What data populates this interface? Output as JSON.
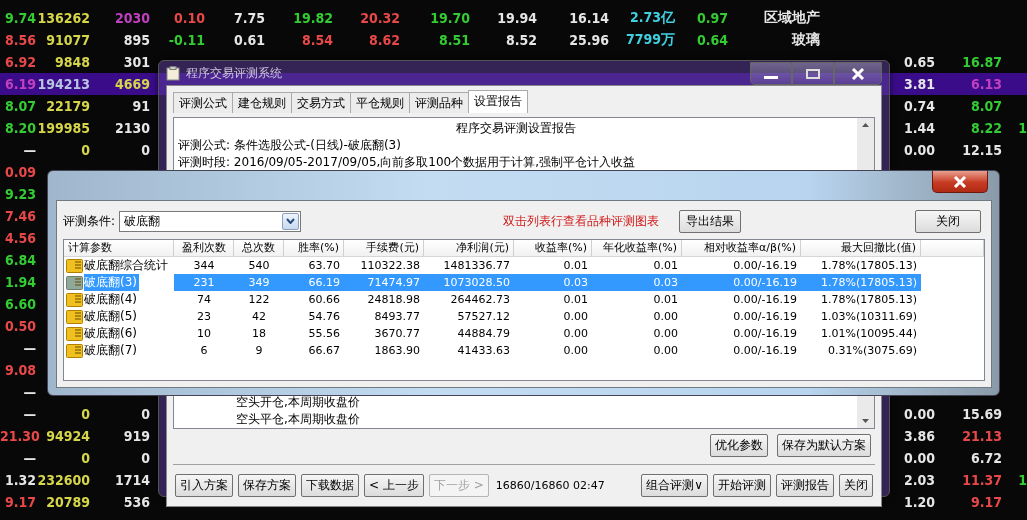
{
  "quote_board": {
    "rows": [
      {
        "highlighted": false,
        "left": [
          {
            "text": "9.74",
            "color": "#33cc33"
          },
          {
            "text": "136262",
            "color": "#d6d64a"
          },
          {
            "text": "2030",
            "color": "#c040c0"
          }
        ],
        "middle": [
          {
            "text": "0.10",
            "color": "#e84848"
          },
          {
            "text": "7.75",
            "color": "#e6e6e6"
          },
          {
            "text": "19.82",
            "color": "#33cc33"
          },
          {
            "text": "20.32",
            "color": "#e84848"
          },
          {
            "text": "19.70",
            "color": "#33cc33"
          },
          {
            "text": "19.94",
            "color": "#e6e6e6"
          },
          {
            "text": "16.14",
            "color": "#e6e6e6"
          },
          {
            "text": "2.73亿",
            "color": "#40d0e0"
          },
          {
            "text": "0.97",
            "color": "#33cc33"
          },
          {
            "text": "区域地产",
            "color": "#e6e6e6"
          }
        ],
        "right": []
      },
      {
        "highlighted": false,
        "left": [
          {
            "text": "8.56",
            "color": "#e84848"
          },
          {
            "text": "91077",
            "color": "#d6d64a"
          },
          {
            "text": "895",
            "color": "#e6e6e6"
          }
        ],
        "middle": [
          {
            "text": "-0.11",
            "color": "#33cc33"
          },
          {
            "text": "0.61",
            "color": "#e6e6e6"
          },
          {
            "text": "8.54",
            "color": "#e84848"
          },
          {
            "text": "8.62",
            "color": "#e84848"
          },
          {
            "text": "8.51",
            "color": "#33cc33"
          },
          {
            "text": "8.52",
            "color": "#e6e6e6"
          },
          {
            "text": "25.96",
            "color": "#e6e6e6"
          },
          {
            "text": "7799万",
            "color": "#40d0e0"
          },
          {
            "text": "0.64",
            "color": "#33cc33"
          },
          {
            "text": "玻璃",
            "color": "#e6e6e6"
          }
        ],
        "right": []
      },
      {
        "highlighted": false,
        "left": [
          {
            "text": "6.92",
            "color": "#e84848"
          },
          {
            "text": "9848",
            "color": "#d6d64a"
          },
          {
            "text": "301",
            "color": "#e6e6e6"
          }
        ],
        "middle": [],
        "right": [
          {
            "text": "0.65",
            "color": "#e6e6e6"
          },
          {
            "text": "16.87",
            "color": "#33cc33"
          }
        ]
      },
      {
        "highlighted": true,
        "left": [
          {
            "text": "6.19",
            "color": "#c040c0"
          },
          {
            "text": "194213",
            "color": "#b8c4e0"
          },
          {
            "text": "4669",
            "color": "#d6d64a"
          }
        ],
        "middle": [],
        "right": [
          {
            "text": "3.81",
            "color": "#e6e6e6"
          },
          {
            "text": "6.13",
            "color": "#c040c0"
          }
        ]
      },
      {
        "highlighted": false,
        "left": [
          {
            "text": "8.07",
            "color": "#33cc33"
          },
          {
            "text": "22179",
            "color": "#d6d64a"
          },
          {
            "text": "91",
            "color": "#e6e6e6"
          }
        ],
        "middle": [],
        "right": [
          {
            "text": "0.74",
            "color": "#e6e6e6"
          },
          {
            "text": "8.07",
            "color": "#33cc33"
          }
        ]
      },
      {
        "highlighted": false,
        "left": [
          {
            "text": "8.20",
            "color": "#33cc33"
          },
          {
            "text": "199985",
            "color": "#d6d64a"
          },
          {
            "text": "2130",
            "color": "#e6e6e6"
          }
        ],
        "middle": [],
        "right": [
          {
            "text": "1.44",
            "color": "#e6e6e6"
          },
          {
            "text": "8.22",
            "color": "#33cc33"
          },
          {
            "text": "1",
            "color": "#33cc33"
          }
        ]
      },
      {
        "highlighted": false,
        "left": [
          {
            "text": "—",
            "color": "#e6e6e6"
          },
          {
            "text": "0",
            "color": "#d6d64a"
          },
          {
            "text": "0",
            "color": "#e6e6e6"
          }
        ],
        "middle": [],
        "right": [
          {
            "text": "0.00",
            "color": "#e6e6e6"
          },
          {
            "text": "12.15",
            "color": "#e6e6e6"
          }
        ]
      },
      {
        "highlighted": false,
        "left": [
          {
            "text": "0.09",
            "color": "#e84848"
          }
        ],
        "middle": [],
        "right": []
      },
      {
        "highlighted": false,
        "left": [
          {
            "text": "9.23",
            "color": "#33cc33"
          }
        ],
        "middle": [],
        "right": []
      },
      {
        "highlighted": false,
        "left": [
          {
            "text": "7.46",
            "color": "#e84848"
          }
        ],
        "middle": [],
        "right": []
      },
      {
        "highlighted": false,
        "left": [
          {
            "text": "4.56",
            "color": "#e84848"
          }
        ],
        "middle": [],
        "right": []
      },
      {
        "highlighted": false,
        "left": [
          {
            "text": "6.84",
            "color": "#33cc33"
          }
        ],
        "middle": [],
        "right": []
      },
      {
        "highlighted": false,
        "left": [
          {
            "text": "1.94",
            "color": "#33cc33"
          }
        ],
        "middle": [],
        "right": []
      },
      {
        "highlighted": false,
        "left": [
          {
            "text": "6.60",
            "color": "#33cc33"
          }
        ],
        "middle": [],
        "right": []
      },
      {
        "highlighted": false,
        "left": [
          {
            "text": "0.50",
            "color": "#e84848"
          }
        ],
        "middle": [],
        "right": []
      },
      {
        "highlighted": false,
        "left": [
          {
            "text": "—",
            "color": "#e6e6e6"
          }
        ],
        "middle": [],
        "right": []
      },
      {
        "highlighted": false,
        "left": [
          {
            "text": "9.08",
            "color": "#e84848"
          }
        ],
        "middle": [],
        "right": []
      },
      {
        "highlighted": false,
        "left": [
          {
            "text": "—",
            "color": "#e6e6e6"
          }
        ],
        "middle": [],
        "right": []
      },
      {
        "highlighted": false,
        "left": [
          {
            "text": "—",
            "color": "#e6e6e6"
          },
          {
            "text": "0",
            "color": "#d6d64a"
          },
          {
            "text": "0",
            "color": "#e6e6e6"
          }
        ],
        "middle": [],
        "right": [
          {
            "text": "0.00",
            "color": "#e6e6e6"
          },
          {
            "text": "15.69",
            "color": "#e6e6e6"
          }
        ]
      },
      {
        "highlighted": false,
        "left": [
          {
            "text": "21.30",
            "color": "#e84848"
          },
          {
            "text": "94924",
            "color": "#d6d64a"
          },
          {
            "text": "919",
            "color": "#e6e6e6"
          }
        ],
        "middle": [],
        "right": [
          {
            "text": "3.86",
            "color": "#e6e6e6"
          },
          {
            "text": "21.13",
            "color": "#e84848"
          }
        ]
      },
      {
        "highlighted": false,
        "left": [
          {
            "text": "—",
            "color": "#e6e6e6"
          },
          {
            "text": "0",
            "color": "#d6d64a"
          },
          {
            "text": "0",
            "color": "#e6e6e6"
          }
        ],
        "middle": [],
        "right": [
          {
            "text": "0.00",
            "color": "#e6e6e6"
          },
          {
            "text": "6.72",
            "color": "#e6e6e6"
          }
        ]
      },
      {
        "highlighted": false,
        "left": [
          {
            "text": "1.32",
            "color": "#e6e6e6"
          },
          {
            "text": "232600",
            "color": "#d6d64a"
          },
          {
            "text": "1714",
            "color": "#e6e6e6"
          }
        ],
        "middle": [],
        "right": [
          {
            "text": "2.03",
            "color": "#e6e6e6"
          },
          {
            "text": "11.37",
            "color": "#e84848"
          },
          {
            "text": "1",
            "color": "#33cc33"
          }
        ]
      },
      {
        "highlighted": false,
        "left": [
          {
            "text": "9.17",
            "color": "#e84848"
          },
          {
            "text": "20789",
            "color": "#d6d64a"
          },
          {
            "text": "536",
            "color": "#e6e6e6"
          }
        ],
        "middle": [],
        "right": [
          {
            "text": "1.20",
            "color": "#e6e6e6"
          },
          {
            "text": "9.17",
            "color": "#e84848"
          }
        ]
      }
    ]
  },
  "main_window": {
    "title": "程序交易评测系统",
    "tabs": [
      {
        "label": "评测公式",
        "selected": false
      },
      {
        "label": "建仓规则",
        "selected": false
      },
      {
        "label": "交易方式",
        "selected": false
      },
      {
        "label": "平仓规则",
        "selected": false
      },
      {
        "label": "评测品种",
        "selected": false
      },
      {
        "label": "设置报告",
        "selected": true
      }
    ],
    "report": {
      "heading": "程序交易评测设置报告",
      "lines": [
        "评测公式: 条件选股公式-(日线)-破底翻(3)",
        "评测时段: 2016/09/05-2017/09/05,向前多取100个数据用于计算,强制平仓计入收益"
      ],
      "bottom_lines": [
        "空头开仓,本周期收盘价",
        "空头平仓,本周期收盘价"
      ]
    },
    "action_buttons": [
      "优化参数",
      "保存为默认方案"
    ],
    "toolbar": [
      {
        "kind": "button",
        "label": "引入方案",
        "disabled": false
      },
      {
        "kind": "button",
        "label": "保存方案",
        "disabled": false
      },
      {
        "kind": "button",
        "label": "下载数据",
        "disabled": false
      },
      {
        "kind": "button",
        "label": "< 上一步",
        "disabled": false
      },
      {
        "kind": "button",
        "label": "下一步 >",
        "disabled": true
      },
      {
        "kind": "status",
        "label": "16860/16860 02:47"
      },
      {
        "kind": "button",
        "label": "组合评测∨",
        "disabled": false
      },
      {
        "kind": "button",
        "label": "开始评测",
        "disabled": false
      },
      {
        "kind": "button",
        "label": "评测报告",
        "disabled": false
      },
      {
        "kind": "button",
        "label": "关闭",
        "disabled": false
      }
    ]
  },
  "result_dialog": {
    "condition_label": "评测条件:",
    "condition_value": "破底翻",
    "hint": "双击列表行查看品种评测图表",
    "export_button": "导出结果",
    "close_button": "关闭",
    "table": {
      "columns": [
        "计算参数",
        "盈利次数",
        "总次数",
        "胜率(%)",
        "手续费(元)",
        "净利润(元)",
        "收益率(%)",
        "年化收益率(%)",
        "相对收益率α/β(%)",
        "最大回撤比(值)"
      ],
      "rows": [
        {
          "selected": false,
          "cells": [
            "破底翻综合统计",
            "344",
            "540",
            "63.70",
            "110322.38",
            "1481336.77",
            "0.01",
            "0.01",
            "0.00/-16.19",
            "1.78%(17805.13)"
          ]
        },
        {
          "selected": true,
          "cells": [
            "破底翻(3)",
            "231",
            "349",
            "66.19",
            "71474.97",
            "1073028.50",
            "0.03",
            "0.03",
            "0.00/-16.19",
            "1.78%(17805.13)"
          ]
        },
        {
          "selected": false,
          "cells": [
            "破底翻(4)",
            "74",
            "122",
            "60.66",
            "24818.98",
            "264462.73",
            "0.01",
            "0.01",
            "0.00/-16.19",
            "1.78%(17805.13)"
          ]
        },
        {
          "selected": false,
          "cells": [
            "破底翻(5)",
            "23",
            "42",
            "54.76",
            "8493.77",
            "57527.12",
            "0.00",
            "0.00",
            "0.00/-16.19",
            "1.03%(10311.69)"
          ]
        },
        {
          "selected": false,
          "cells": [
            "破底翻(6)",
            "10",
            "18",
            "55.56",
            "3670.77",
            "44884.79",
            "0.00",
            "0.00",
            "0.00/-16.19",
            "1.01%(10095.44)"
          ]
        },
        {
          "selected": false,
          "cells": [
            "破底翻(7)",
            "6",
            "9",
            "66.67",
            "1863.90",
            "41433.63",
            "0.00",
            "0.00",
            "0.00/-16.19",
            "0.31%(3075.69)"
          ]
        }
      ]
    }
  }
}
